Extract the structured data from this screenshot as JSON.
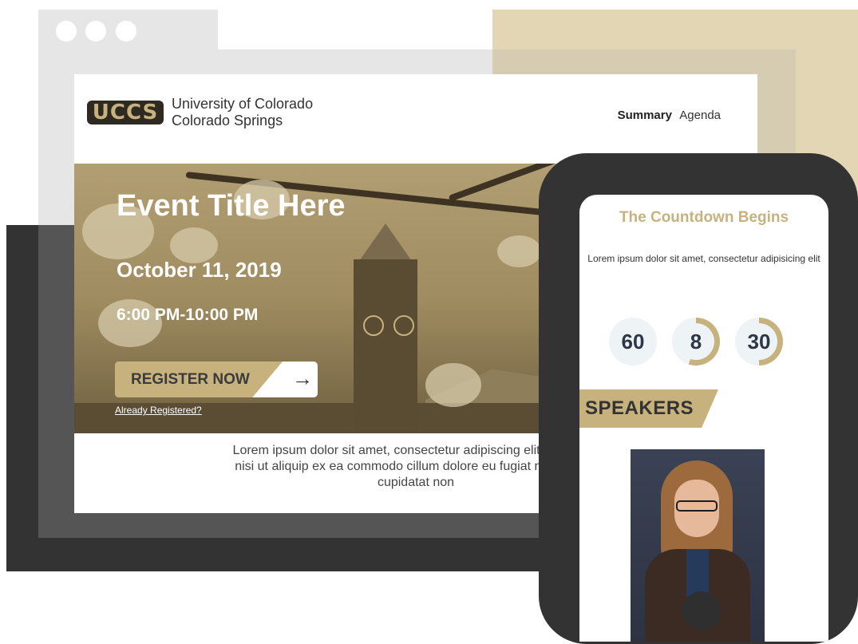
{
  "colors": {
    "accent_gold": "#c7b27e",
    "dark_frame": "#333333",
    "timer_text": "#2d3746"
  },
  "browser": {
    "window_controls": [
      "dot",
      "dot",
      "dot"
    ]
  },
  "header": {
    "logo_text": "UCCS",
    "university_line1": "University of Colorado",
    "university_line2": "Colorado Springs",
    "nav": {
      "summary": "Summary",
      "agenda": "Agenda"
    }
  },
  "hero": {
    "title": "Event Title Here",
    "date": "October 11, 2019",
    "time": "6:00 PM-10:00 PM",
    "register_label": "REGISTER NOW",
    "register_icon": "arrow-right-icon",
    "already_registered": "Already Registered?"
  },
  "body": {
    "lorem_line1": "Lorem ipsum dolor sit amet, consectetur adipiscing elit, sed do ei",
    "lorem_line2": "nisi ut aliquip ex ea commodo cillum dolore eu fugiat nulla pariat",
    "lorem_line3": "cupidatat non"
  },
  "mobile": {
    "countdown_title": "The Countdown Begins",
    "countdown_sub": "Lorem ipsum dolor sit amet, consectetur adipisicing elit",
    "timers": [
      {
        "value": "60",
        "progress": 0.0
      },
      {
        "value": "8",
        "progress": 0.55
      },
      {
        "value": "30",
        "progress": 0.5
      }
    ],
    "speakers_label": "SPEAKERS"
  }
}
